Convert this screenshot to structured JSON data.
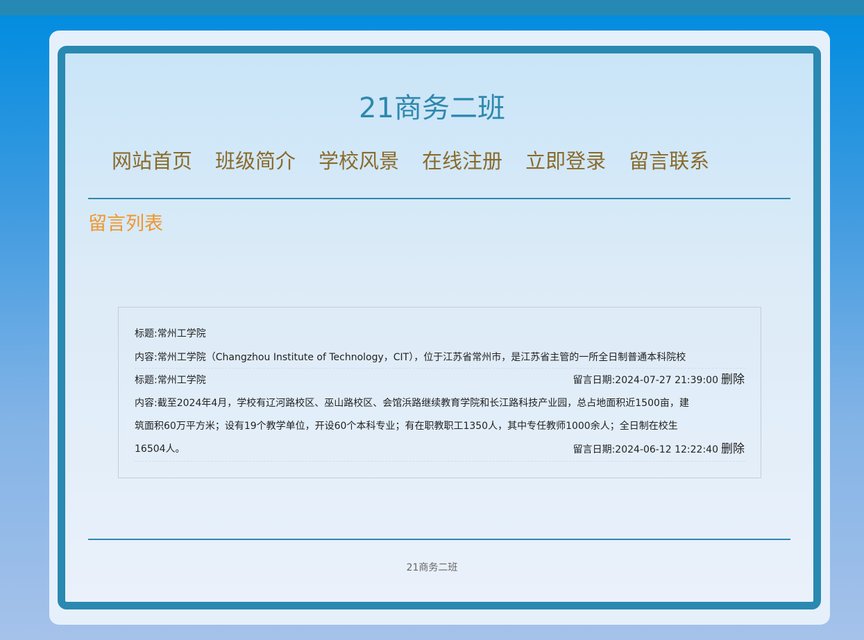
{
  "site": {
    "title": "21商务二班",
    "footer": "21商务二班"
  },
  "nav": {
    "items": [
      "网站首页",
      "班级简介",
      "学校风景",
      "在线注册",
      "立即登录",
      "留言联系"
    ]
  },
  "section": {
    "title": "留言列表"
  },
  "messages": [
    {
      "title": "标题:常州工学院",
      "content_lines": [
        "内容:常州工学院（Changzhou Institute of Technology，CIT），位于江苏省常州市，是江苏省主管的一所全日制普通本科院校"
      ],
      "date": "留言日期:2024-07-27 21:39:00",
      "delete_label": "删除"
    },
    {
      "title": "标题:常州工学院",
      "content_lines": [
        "内容:截至2024年4月，学校有辽河路校区、巫山路校区、会馆浜路继续教育学院和长江路科技产业园，总占地面积近1500亩，建",
        "筑面积60万平方米；设有19个教学单位，开设60个本科专业；有在职教职工1350人，其中专任教师1000余人；全日制在校生",
        "16504人。"
      ],
      "date": "留言日期:2024-06-12 12:22:40",
      "delete_label": "删除"
    }
  ],
  "colors": {
    "background_top": "#008ce0",
    "frame_border": "#2989b0",
    "title": "#2e88ad",
    "nav": "#8a6a2c",
    "section_title": "#f0962e"
  }
}
